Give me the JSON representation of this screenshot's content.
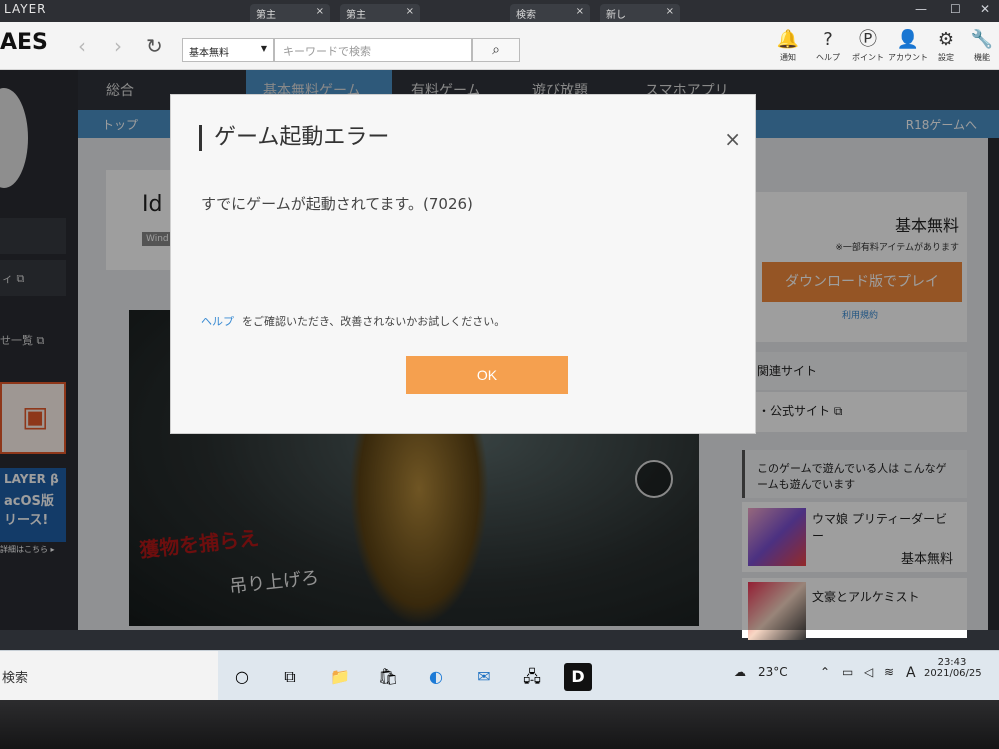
{
  "window": {
    "app_title": "LAYER",
    "tabs": [
      {
        "label": "第主"
      },
      {
        "label": "第主"
      },
      {
        "label": "検索"
      },
      {
        "label": "新し"
      }
    ],
    "window_buttons": [
      "—",
      "☐",
      "✕"
    ]
  },
  "toolbar": {
    "logo": "AES",
    "back": "‹",
    "forward": "›",
    "reload": "↻",
    "category_select": "基本無料",
    "search_placeholder": "キーワードで検索",
    "search_button_icon": "search-icon",
    "tools": [
      {
        "label": "通知",
        "icon": "bell-icon",
        "glyph": "🔔"
      },
      {
        "label": "ヘルプ",
        "icon": "help-icon",
        "glyph": "?"
      },
      {
        "label": "ポイント",
        "icon": "point-icon",
        "glyph": "Ⓟ"
      },
      {
        "label": "アカウント",
        "icon": "account-icon",
        "glyph": "👤"
      },
      {
        "label": "設定",
        "icon": "gear-icon",
        "glyph": "⚙"
      },
      {
        "label": "機能",
        "icon": "wrench-icon",
        "glyph": "🔧"
      }
    ]
  },
  "nav": {
    "tabs": [
      "総合",
      "基本無料ゲーム",
      "有料ゲーム",
      "遊び放題",
      "スマホアプリ"
    ],
    "breadcrumb": "トップ",
    "r18_link": "R18ゲームへ"
  },
  "left_sidebar": {
    "items": [
      "ィ",
      "せ一覧"
    ],
    "promo_text": "LAYER β",
    "promo_sub1": "acOS版",
    "promo_sub2": "リース!",
    "promo_more": "詳細はこちら ▸"
  },
  "game": {
    "title_fragment": "Id",
    "platform_tag": "Wind",
    "overlay_line1": "獲物を捕らえ",
    "overlay_line2": "吊り上げろ"
  },
  "right_sidebar": {
    "price": "基本無料",
    "note": "※一部有料アイテムがあります",
    "download_button": "ダウンロード版でプレイ",
    "terms": "利用規約",
    "related_heading": "関連サイト",
    "official_site": "・公式サイト",
    "also_played_heading": "このゲームで遊んでいる人は こんなゲームも遊んでいます",
    "recommendations": [
      {
        "title": "ウマ娘 プリティーダービー",
        "price": "基本無料"
      },
      {
        "title": "文豪とアルケミスト",
        "price": ""
      }
    ]
  },
  "dialog": {
    "title": "ゲーム起動エラー",
    "close": "×",
    "message": "すでにゲームが起動されてます。(7026)",
    "help_link": "ヘルプ",
    "help_text": "をご確認いただき、改善されないかお試しください。",
    "ok_button": "OK",
    "ok_color": "#f5a04f"
  },
  "taskbar": {
    "search_label": "検索",
    "apps": [
      {
        "name": "cortana-icon",
        "glyph": "○"
      },
      {
        "name": "task-view-icon",
        "glyph": "⧉"
      },
      {
        "name": "file-explorer-icon",
        "glyph": "📁"
      },
      {
        "name": "store-icon",
        "glyph": "🛍"
      },
      {
        "name": "edge-icon",
        "glyph": "◐"
      },
      {
        "name": "mail-icon",
        "glyph": "✉"
      },
      {
        "name": "network-app-icon",
        "glyph": "🖧"
      },
      {
        "name": "dmm-icon",
        "glyph": "D"
      }
    ],
    "weather": "23°C",
    "ime": "A",
    "time": "23:43",
    "date": "2021/06/25"
  }
}
